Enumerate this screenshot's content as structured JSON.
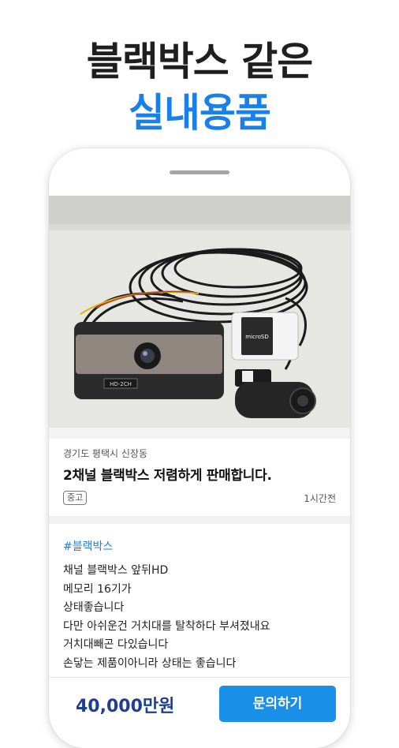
{
  "headline": {
    "line1": "블랙박스 같은",
    "line2": "실내용품"
  },
  "listing": {
    "location": "경기도 평택시 신장동",
    "title": "2채널 블랙박스 저렴하게 판매합니다.",
    "condition_badge": "중고",
    "posted_time": "1시간전",
    "hashtag": "#블랙박스",
    "description_lines": [
      "채널 블랙박스 앞뒤HD",
      "메모리 16기가",
      "상태좋습니다",
      "다만 아쉬운건 거치대를 탈착하다 부셔졌내요",
      "거치대빼곤 다있습니다",
      "손닿는 제품이아니라 상태는 좋습니다"
    ]
  },
  "product_photo": {
    "device_label": "HD-2CH",
    "card_label": "microSD"
  },
  "bottom_bar": {
    "price": "40,000만원",
    "inquire_button": "문의하기"
  },
  "colors": {
    "accent_blue": "#1a7fe8",
    "price_navy": "#1e3e8f",
    "button_blue": "#1a8fe8"
  }
}
